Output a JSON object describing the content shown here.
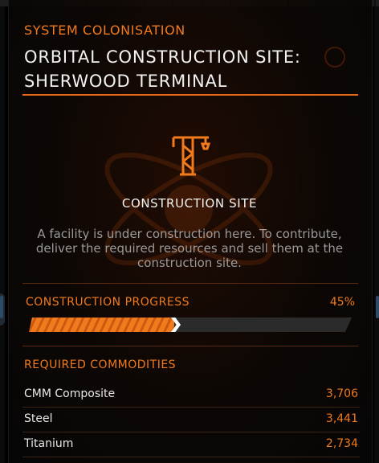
{
  "header": {
    "category": "SYSTEM COLONISATION",
    "title_line1": "ORBITAL CONSTRUCTION SITE:",
    "title_line2": "SHERWOOD TERMINAL"
  },
  "site": {
    "icon": "crane-icon",
    "label": "CONSTRUCTION SITE",
    "description": "A facility is under construction here. To contribute, deliver the required resources and sell them at the construction site."
  },
  "progress": {
    "label": "CONSTRUCTION PROGRESS",
    "value_text": "45%",
    "fraction": 0.45
  },
  "commodities": {
    "heading": "REQUIRED COMMODITIES",
    "items": [
      {
        "name": "CMM Composite",
        "quantity": "3,706"
      },
      {
        "name": "Steel",
        "quantity": "3,441"
      },
      {
        "name": "Titanium",
        "quantity": "2,734"
      }
    ]
  },
  "colors": {
    "accent": "#f07a1c",
    "text": "#f2f2f2",
    "muted": "#9a9a9a",
    "background": "#000000"
  }
}
